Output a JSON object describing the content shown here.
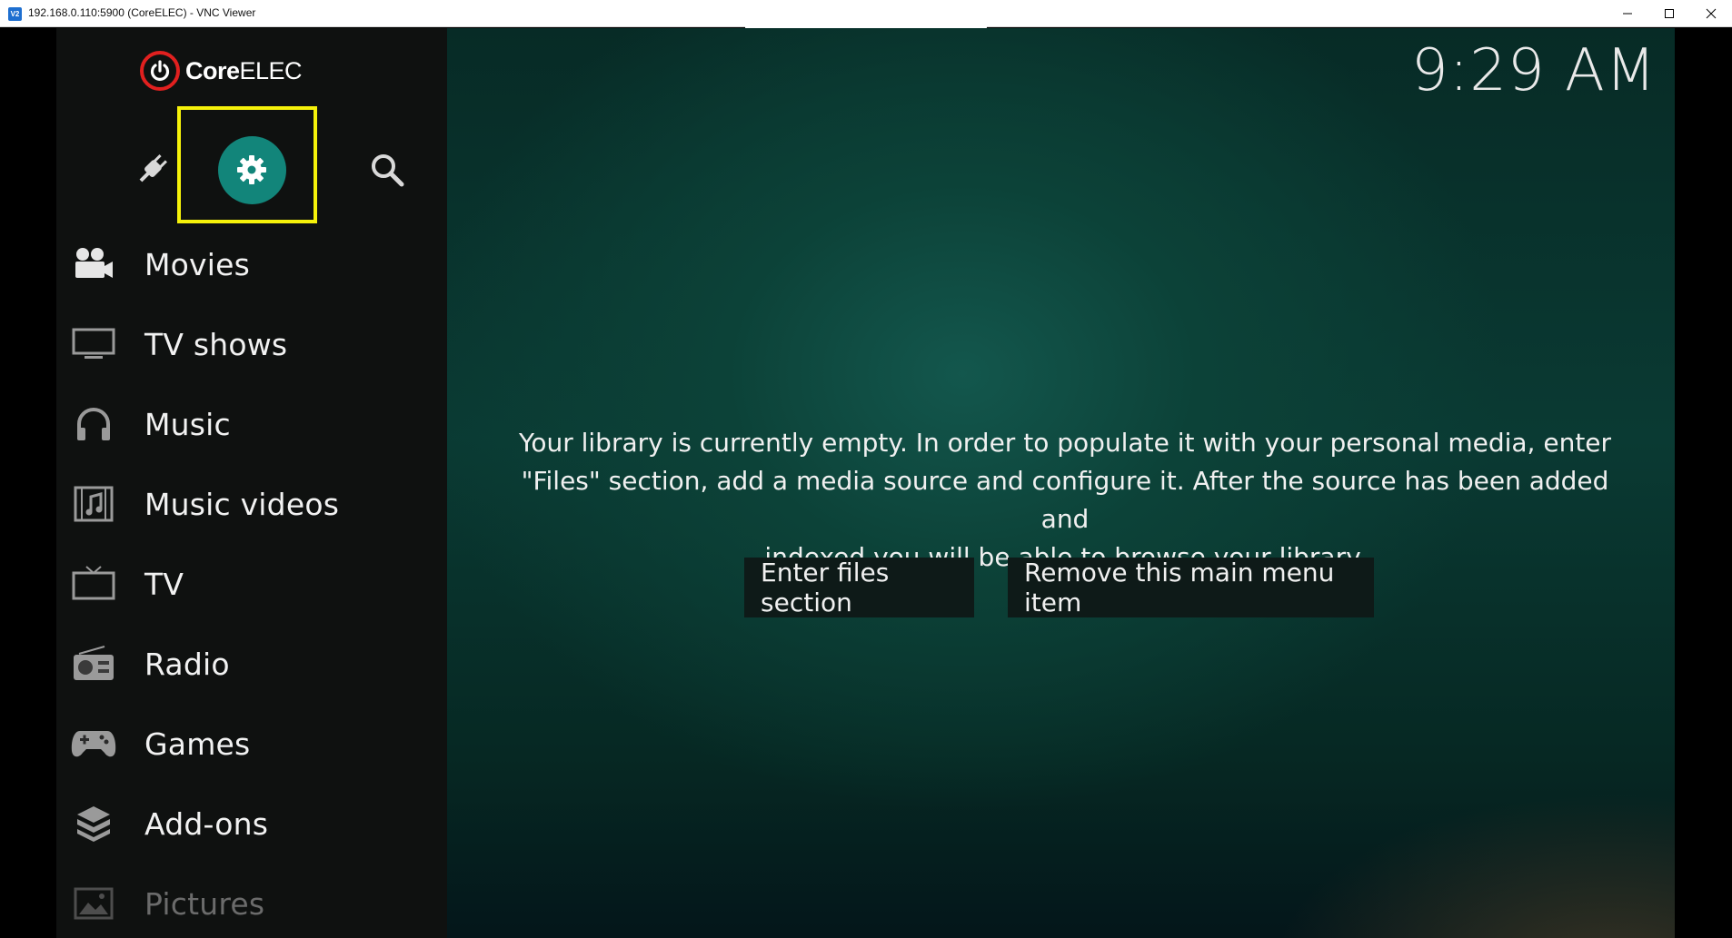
{
  "window": {
    "icon_label": "V2",
    "title": "192.168.0.110:5900 (CoreELEC) - VNC Viewer"
  },
  "app": {
    "logo_prefix": "Core",
    "logo_suffix": "ELEC",
    "brand_color": "#e1201f",
    "accent_color": "#12857a",
    "highlight_color": "#f6f20a",
    "clock": "9:29 AM"
  },
  "top_icons": [
    {
      "name": "addons-plug-icon"
    },
    {
      "name": "settings-gear-icon",
      "selected": true
    },
    {
      "name": "search-icon"
    }
  ],
  "menu": {
    "items": [
      {
        "label": "Movies",
        "icon": "movie-camera-icon"
      },
      {
        "label": "TV shows",
        "icon": "monitor-icon"
      },
      {
        "label": "Music",
        "icon": "headphones-icon"
      },
      {
        "label": "Music videos",
        "icon": "music-video-icon"
      },
      {
        "label": "TV",
        "icon": "tv-icon"
      },
      {
        "label": "Radio",
        "icon": "radio-icon"
      },
      {
        "label": "Games",
        "icon": "gamepad-icon"
      },
      {
        "label": "Add-ons",
        "icon": "addons-box-icon"
      },
      {
        "label": "Pictures",
        "icon": "pictures-icon"
      }
    ]
  },
  "main": {
    "message_line1": "Your library is currently empty. In order to populate it with your personal media, enter",
    "message_line2": "\"Files\" section, add a media source and configure it. After the source has been added and",
    "message_line3": "indexed you will be able to browse your library.",
    "enter_files_label": "Enter files section",
    "remove_item_label": "Remove this main menu item"
  }
}
